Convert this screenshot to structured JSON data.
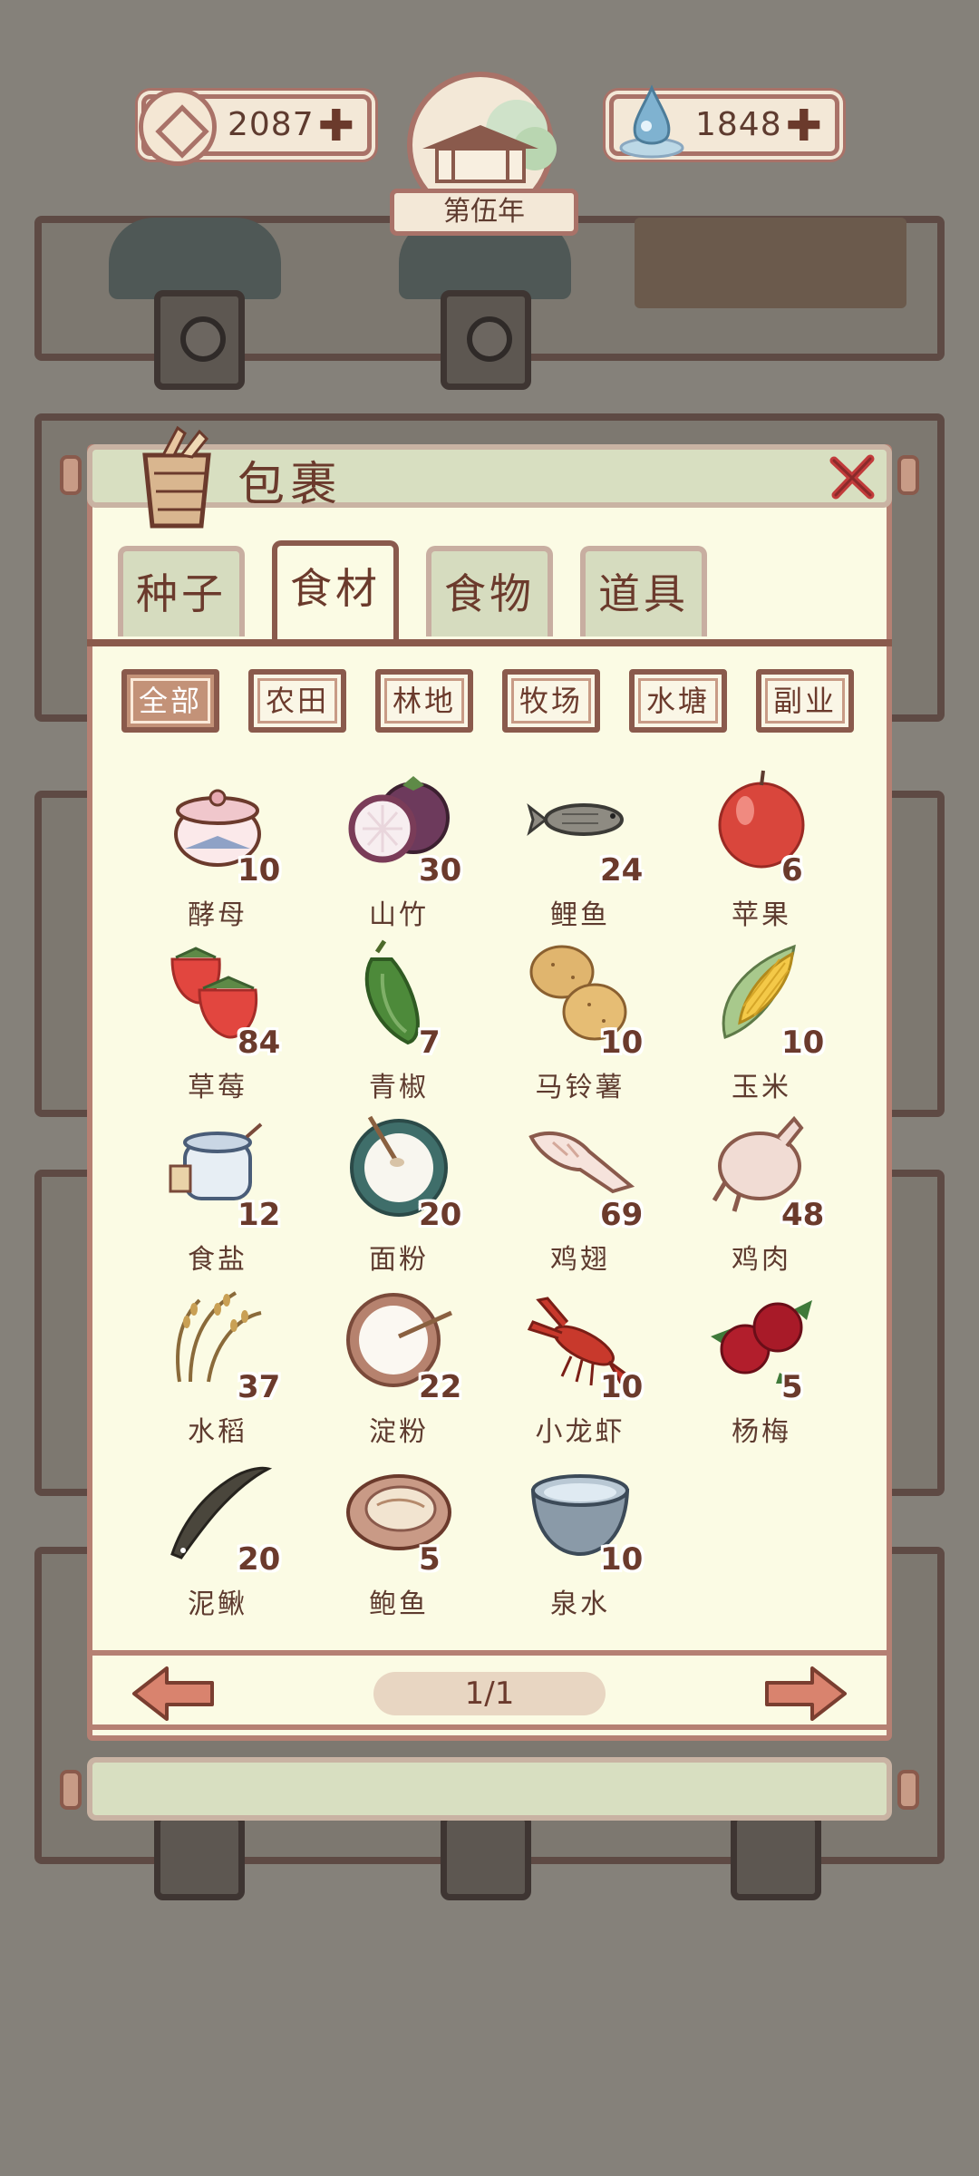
{
  "currency": {
    "coins": "2087",
    "spirit": "1848",
    "plus": "✚"
  },
  "year": "第伍年",
  "panel": {
    "title": "包裹"
  },
  "tabs": [
    {
      "label": "种子",
      "active": false
    },
    {
      "label": "食材",
      "active": true
    },
    {
      "label": "食物",
      "active": false
    },
    {
      "label": "道具",
      "active": false
    }
  ],
  "filters": [
    {
      "label": "全部",
      "active": true
    },
    {
      "label": "农田",
      "active": false
    },
    {
      "label": "林地",
      "active": false
    },
    {
      "label": "牧场",
      "active": false
    },
    {
      "label": "水塘",
      "active": false
    },
    {
      "label": "副业",
      "active": false
    }
  ],
  "items": [
    {
      "name": "酵母",
      "count": "10",
      "icon": "yeast-icon"
    },
    {
      "name": "山竹",
      "count": "30",
      "icon": "mangosteen-icon"
    },
    {
      "name": "鲤鱼",
      "count": "24",
      "icon": "carp-icon"
    },
    {
      "name": "苹果",
      "count": "6",
      "icon": "apple-icon"
    },
    {
      "name": "草莓",
      "count": "84",
      "icon": "strawberry-icon"
    },
    {
      "name": "青椒",
      "count": "7",
      "icon": "green-pepper-icon"
    },
    {
      "name": "马铃薯",
      "count": "10",
      "icon": "potato-icon"
    },
    {
      "name": "玉米",
      "count": "10",
      "icon": "corn-icon"
    },
    {
      "name": "食盐",
      "count": "12",
      "icon": "salt-icon"
    },
    {
      "name": "面粉",
      "count": "20",
      "icon": "flour-icon"
    },
    {
      "name": "鸡翅",
      "count": "69",
      "icon": "chicken-wing-icon"
    },
    {
      "name": "鸡肉",
      "count": "48",
      "icon": "chicken-icon"
    },
    {
      "name": "水稻",
      "count": "37",
      "icon": "rice-icon"
    },
    {
      "name": "淀粉",
      "count": "22",
      "icon": "starch-icon"
    },
    {
      "name": "小龙虾",
      "count": "10",
      "icon": "crayfish-icon"
    },
    {
      "name": "杨梅",
      "count": "5",
      "icon": "bayberry-icon"
    },
    {
      "name": "泥鳅",
      "count": "20",
      "icon": "loach-icon"
    },
    {
      "name": "鲍鱼",
      "count": "5",
      "icon": "abalone-icon"
    },
    {
      "name": "泉水",
      "count": "10",
      "icon": "spring-water-icon"
    }
  ],
  "pager": {
    "page": "1/1"
  },
  "colors": {
    "accent": "#8a5a4c",
    "panel": "#fbfbe4",
    "active_filter": "#c39278"
  }
}
